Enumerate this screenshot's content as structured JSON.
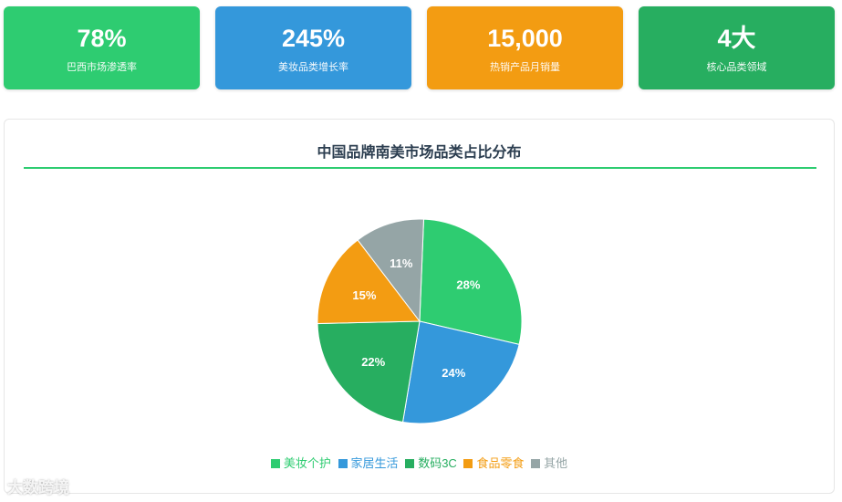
{
  "stats": [
    {
      "value": "78%",
      "label": "巴西市场渗透率",
      "color": "#2ecc71"
    },
    {
      "value": "245%",
      "label": "美妆品类增长率",
      "color": "#3498db"
    },
    {
      "value": "15,000",
      "label": "热销产品月销量",
      "color": "#f39c12"
    },
    {
      "value": "4大",
      "label": "核心品类领域",
      "color": "#27ae60"
    }
  ],
  "chart_data": {
    "type": "pie",
    "title": "中国品牌南美市场品类占比分布",
    "categories": [
      "美妆个护",
      "家居生活",
      "数码3C",
      "食品零食",
      "其他"
    ],
    "values": [
      28,
      24,
      22,
      15,
      11
    ],
    "labels": [
      "28%",
      "24%",
      "22%",
      "15%",
      "11%"
    ],
    "colors": [
      "#2ecc71",
      "#3498db",
      "#27ae60",
      "#f39c12",
      "#95a5a6"
    ],
    "legend_position": "bottom"
  },
  "watermark": "大数跨境"
}
